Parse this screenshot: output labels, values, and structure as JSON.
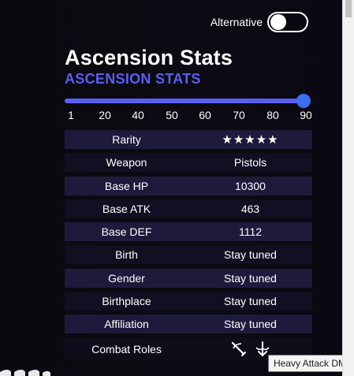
{
  "toggle": {
    "label": "Alternative",
    "checked": false
  },
  "header": {
    "title": "Ascension Stats",
    "subtitle": "ASCENSION STATS"
  },
  "slider": {
    "value": 90,
    "ticks": [
      "1",
      "20",
      "40",
      "50",
      "60",
      "70",
      "80",
      "90"
    ]
  },
  "stats": [
    {
      "label": "Rarity",
      "value": "★★★★★"
    },
    {
      "label": "Weapon",
      "value": "Pistols"
    },
    {
      "label": "Base HP",
      "value": "10300"
    },
    {
      "label": "Base ATK",
      "value": "463"
    },
    {
      "label": "Base DEF",
      "value": "1112"
    },
    {
      "label": "Birth",
      "value": "Stay tuned"
    },
    {
      "label": "Gender",
      "value": "Stay tuned"
    },
    {
      "label": "Birthplace",
      "value": "Stay tuned"
    },
    {
      "label": "Affiliation",
      "value": "Stay tuned"
    }
  ],
  "combat_roles": {
    "label": "Combat Roles",
    "icons": [
      "sword-slash-icon",
      "heavy-attack-icon"
    ]
  },
  "tooltip": {
    "text": "Heavy Attack DMG"
  },
  "colors": {
    "accent": "#5b5ff0",
    "slider_thumb": "#3b6ff5",
    "row_odd": "#1d1a3b",
    "row_even": "#120f22",
    "background": "#0a0810"
  }
}
